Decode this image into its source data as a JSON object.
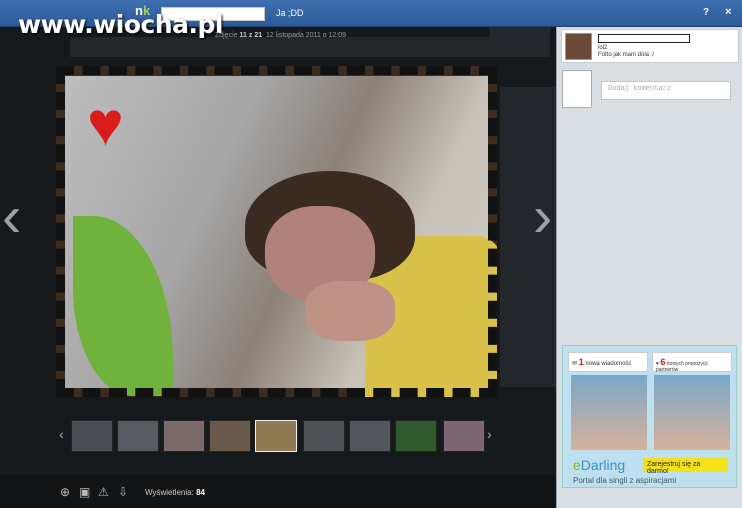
{
  "watermark": "www.wiocha.pl",
  "topbar": {
    "logo_prefix": "n",
    "logo_suffix": "k",
    "album_title": "Ja ;DD",
    "help_label": "?",
    "close_label": "×"
  },
  "photo_meta": {
    "prefix": "Zdjęcie",
    "position": "11 z 21",
    "date": "12 listopada 2011 o 12:09"
  },
  "navigation": {
    "prev_icon": "chevron-left-icon",
    "next_icon": "chevron-right-icon",
    "prev_glyph": "‹",
    "next_glyph": "›"
  },
  "thumbnails": {
    "prev_glyph": "‹",
    "next_glyph": "›",
    "count": 9,
    "active_index": 4
  },
  "toolbar": {
    "views_label": "Wyświetlenia:",
    "views_count": "84"
  },
  "comments": [
    {
      "user": "lol2",
      "text": "Fotto jak mam dola ;/"
    }
  ],
  "add_comment": {
    "placeholder": "Dodaj komentarz"
  },
  "ad": {
    "box1_num": "1",
    "box1_text": "nowa wiadomość",
    "box2_num": "6",
    "box2_text": "nowych propozycji partnerów",
    "brand_e": "e",
    "brand_rest": "Darling",
    "cta": "Zarejestruj się za darmo!",
    "tagline": "Portal dla singli z aspiracjami"
  },
  "colors": {
    "topbar": "#2d5a98",
    "panel": "#d9dee3",
    "ad_bg": "#bfe0ef"
  }
}
